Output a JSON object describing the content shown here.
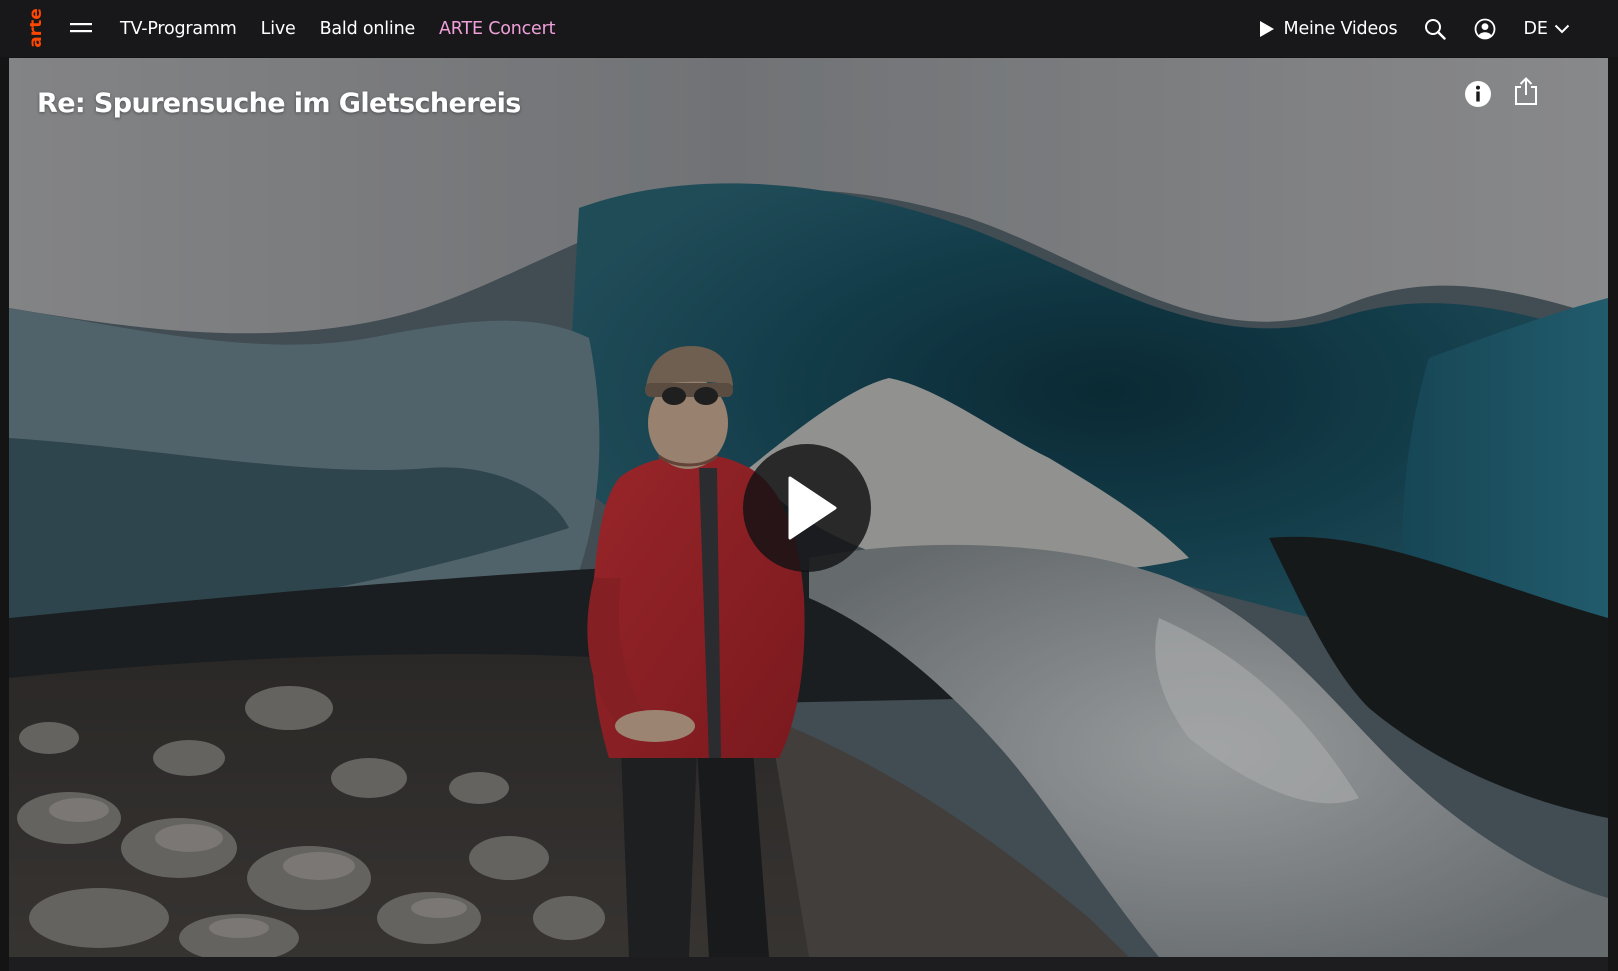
{
  "header": {
    "logo_alt": "arte",
    "nav": [
      {
        "label": "TV-Programm"
      },
      {
        "label": "Live"
      },
      {
        "label": "Bald online"
      },
      {
        "label": "ARTE Concert"
      }
    ],
    "my_videos_label": "Meine Videos",
    "language": "DE",
    "icons": {
      "menu": "hamburger-icon",
      "play": "play-icon",
      "search": "search-icon",
      "account": "user-icon",
      "language": "chevron-down-icon"
    },
    "colors": {
      "background": "#18181a",
      "logo": "#fd4600",
      "concert": "#f0a0d8"
    }
  },
  "player": {
    "title": "Re: Spurensuche im Gletschereis",
    "icons": {
      "info": "info-icon",
      "share": "share-icon",
      "play": "play-button-icon"
    }
  }
}
